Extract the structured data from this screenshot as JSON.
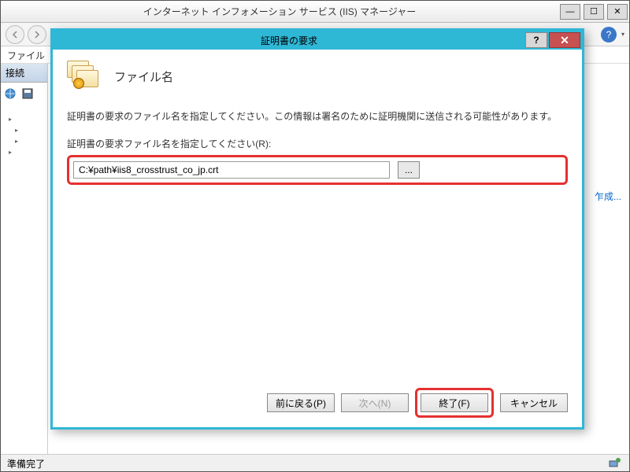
{
  "main": {
    "title": "インターネット インフォメーション サービス (IIS) マネージャー",
    "menubar": {
      "file": "ファイル"
    },
    "sidebar": {
      "header": "接続"
    },
    "action_link": "乍成...",
    "statusbar": "準備完了"
  },
  "dialog": {
    "title": "証明書の要求",
    "heading": "ファイル名",
    "instruction": "証明書の要求のファイル名を指定してください。この情報は署名のために証明機関に送信される可能性があります。",
    "field_label": "証明書の要求ファイル名を指定してください(R):",
    "file_value": "C:¥path¥iis8_crosstrust_co_jp.crt",
    "browse_label": "...",
    "buttons": {
      "back": "前に戻る(P)",
      "next": "次へ(N)",
      "finish": "終了(F)",
      "cancel": "キャンセル"
    },
    "help": "?",
    "close": "✕"
  },
  "winbtns": {
    "min": "—",
    "max": "☐",
    "close": "✕"
  }
}
